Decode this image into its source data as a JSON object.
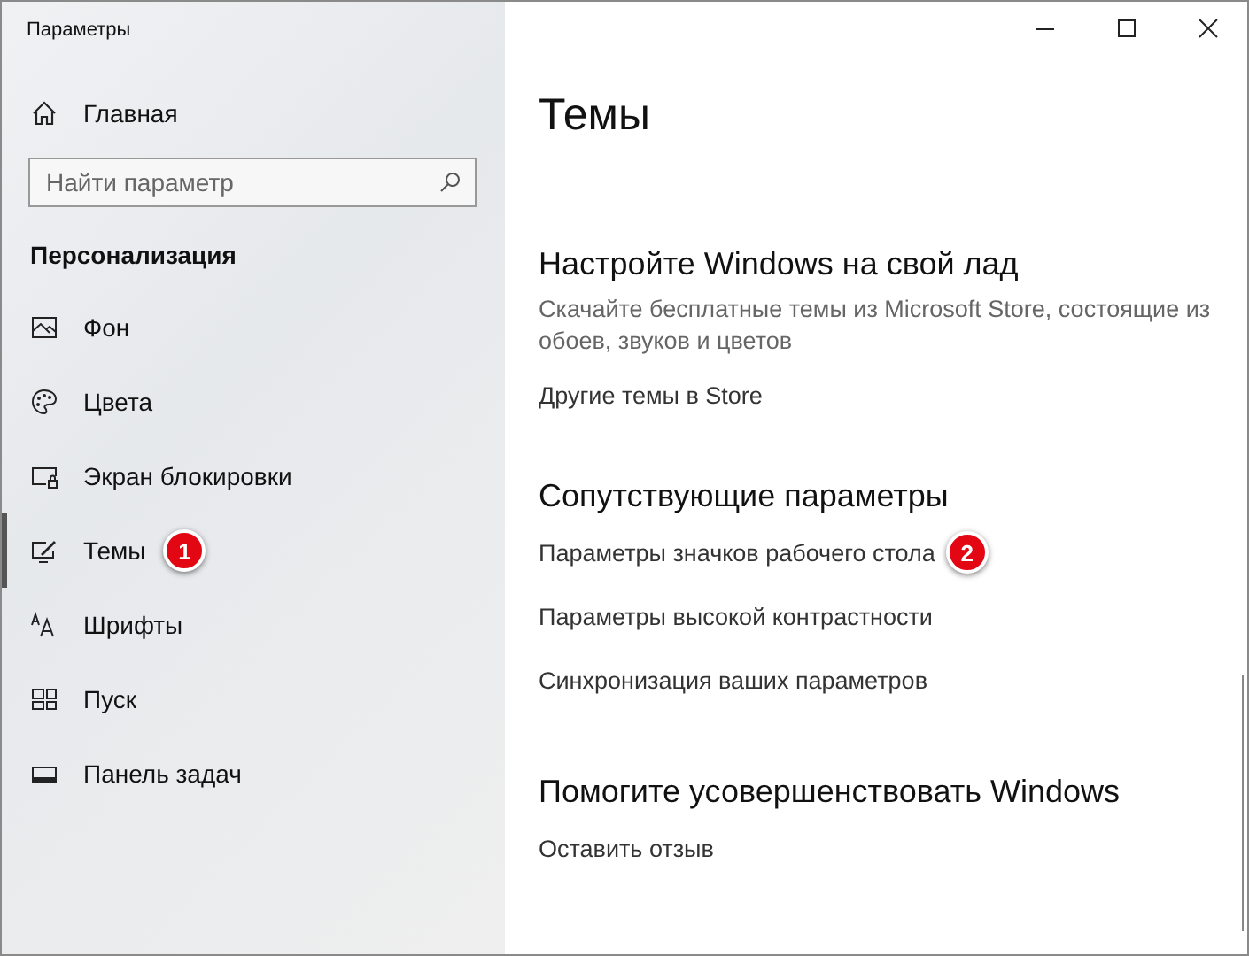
{
  "window": {
    "title": "Параметры"
  },
  "sidebar": {
    "home": "Главная",
    "search": {
      "placeholder": "Найти параметр"
    },
    "heading": "Персонализация",
    "items": [
      {
        "kind": "background",
        "label": "Фон",
        "selected": false
      },
      {
        "kind": "colors",
        "label": "Цвета",
        "selected": false
      },
      {
        "kind": "lockscreen",
        "label": "Экран блокировки",
        "selected": false
      },
      {
        "kind": "themes",
        "label": "Темы",
        "selected": true,
        "badge": "1"
      },
      {
        "kind": "fonts",
        "label": "Шрифты",
        "selected": false
      },
      {
        "kind": "start",
        "label": "Пуск",
        "selected": false
      },
      {
        "kind": "taskbar",
        "label": "Панель задач",
        "selected": false
      }
    ]
  },
  "page": {
    "title": "Темы",
    "sections": [
      {
        "heading": "Настройте Windows на свой лад",
        "description": "Скачайте бесплатные темы из Microsoft Store, состоящие из обоев, звуков и цветов",
        "links": [
          {
            "label": "Другие темы в Store"
          }
        ]
      },
      {
        "heading": "Сопутствующие параметры",
        "links": [
          {
            "label": "Параметры значков рабочего стола",
            "badge": "2"
          },
          {
            "label": "Параметры высокой контрастности"
          },
          {
            "label": "Синхронизация ваших параметров"
          }
        ]
      },
      {
        "heading": "Помогите усовершенствовать Windows",
        "links": [
          {
            "label": "Оставить отзыв"
          }
        ]
      }
    ]
  }
}
